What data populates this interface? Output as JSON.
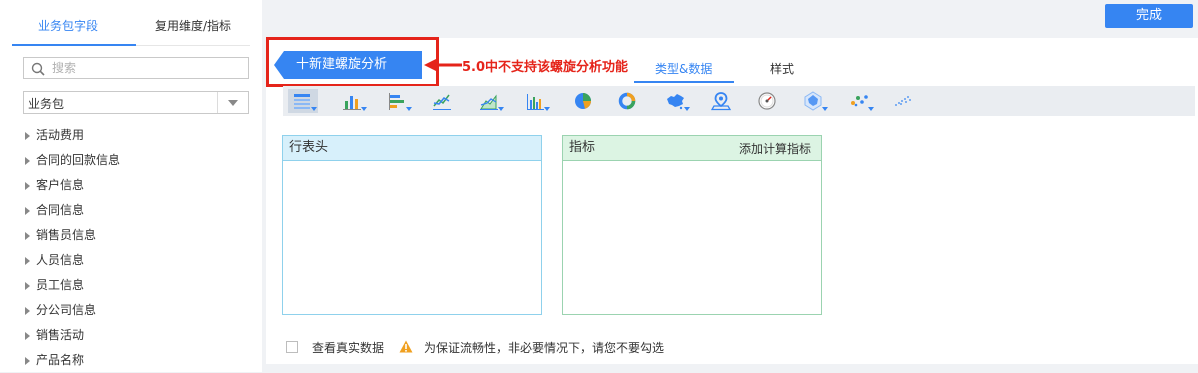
{
  "left_panel": {
    "tabs": [
      {
        "label": "业务包字段",
        "active": true
      },
      {
        "label": "复用维度/指标",
        "active": false
      }
    ],
    "search": {
      "placeholder": "搜索",
      "value": ""
    },
    "package_select": {
      "value": "业务包"
    },
    "tree_items": [
      {
        "label": "活动费用"
      },
      {
        "label": "合同的回款信息"
      },
      {
        "label": "客户信息"
      },
      {
        "label": "合同信息"
      },
      {
        "label": "销售员信息"
      },
      {
        "label": "人员信息"
      },
      {
        "label": "员工信息"
      },
      {
        "label": "分公司信息"
      },
      {
        "label": "销售活动"
      },
      {
        "label": "产品名称"
      }
    ]
  },
  "header": {
    "done_label": "完成"
  },
  "chart_panel": {
    "new_button_label": "十新建螺旋分析",
    "annotation": "5.0中不支持该螺旋分析功能",
    "tabs": [
      {
        "label": "类型&数据",
        "active": true
      },
      {
        "label": "样式",
        "active": false
      }
    ],
    "toolbar_icons": [
      "table-icon",
      "bar-chart-icon",
      "horizontal-bar-icon",
      "line-chart-icon",
      "area-chart-icon",
      "combo-chart-icon",
      "pie-chart-icon",
      "donut-chart-icon",
      "china-map-icon",
      "location-map-icon",
      "gauge-icon",
      "radar-icon",
      "scatter-icon",
      "dot-chart-icon"
    ],
    "rows_box": {
      "title": "行表头"
    },
    "metrics_box": {
      "title": "指标",
      "action": "添加计算指标"
    },
    "footer": {
      "checkbox_label": "查看真实数据",
      "warning": "为保证流畅性，非必要情况下，请您不要勾选"
    }
  },
  "colors": {
    "accent": "#3685f2",
    "highlight_red": "#e5241a",
    "rows_header_bg": "#d7f0fb",
    "metrics_header_bg": "#dcf4e3",
    "warning_orange": "#f0a020"
  }
}
